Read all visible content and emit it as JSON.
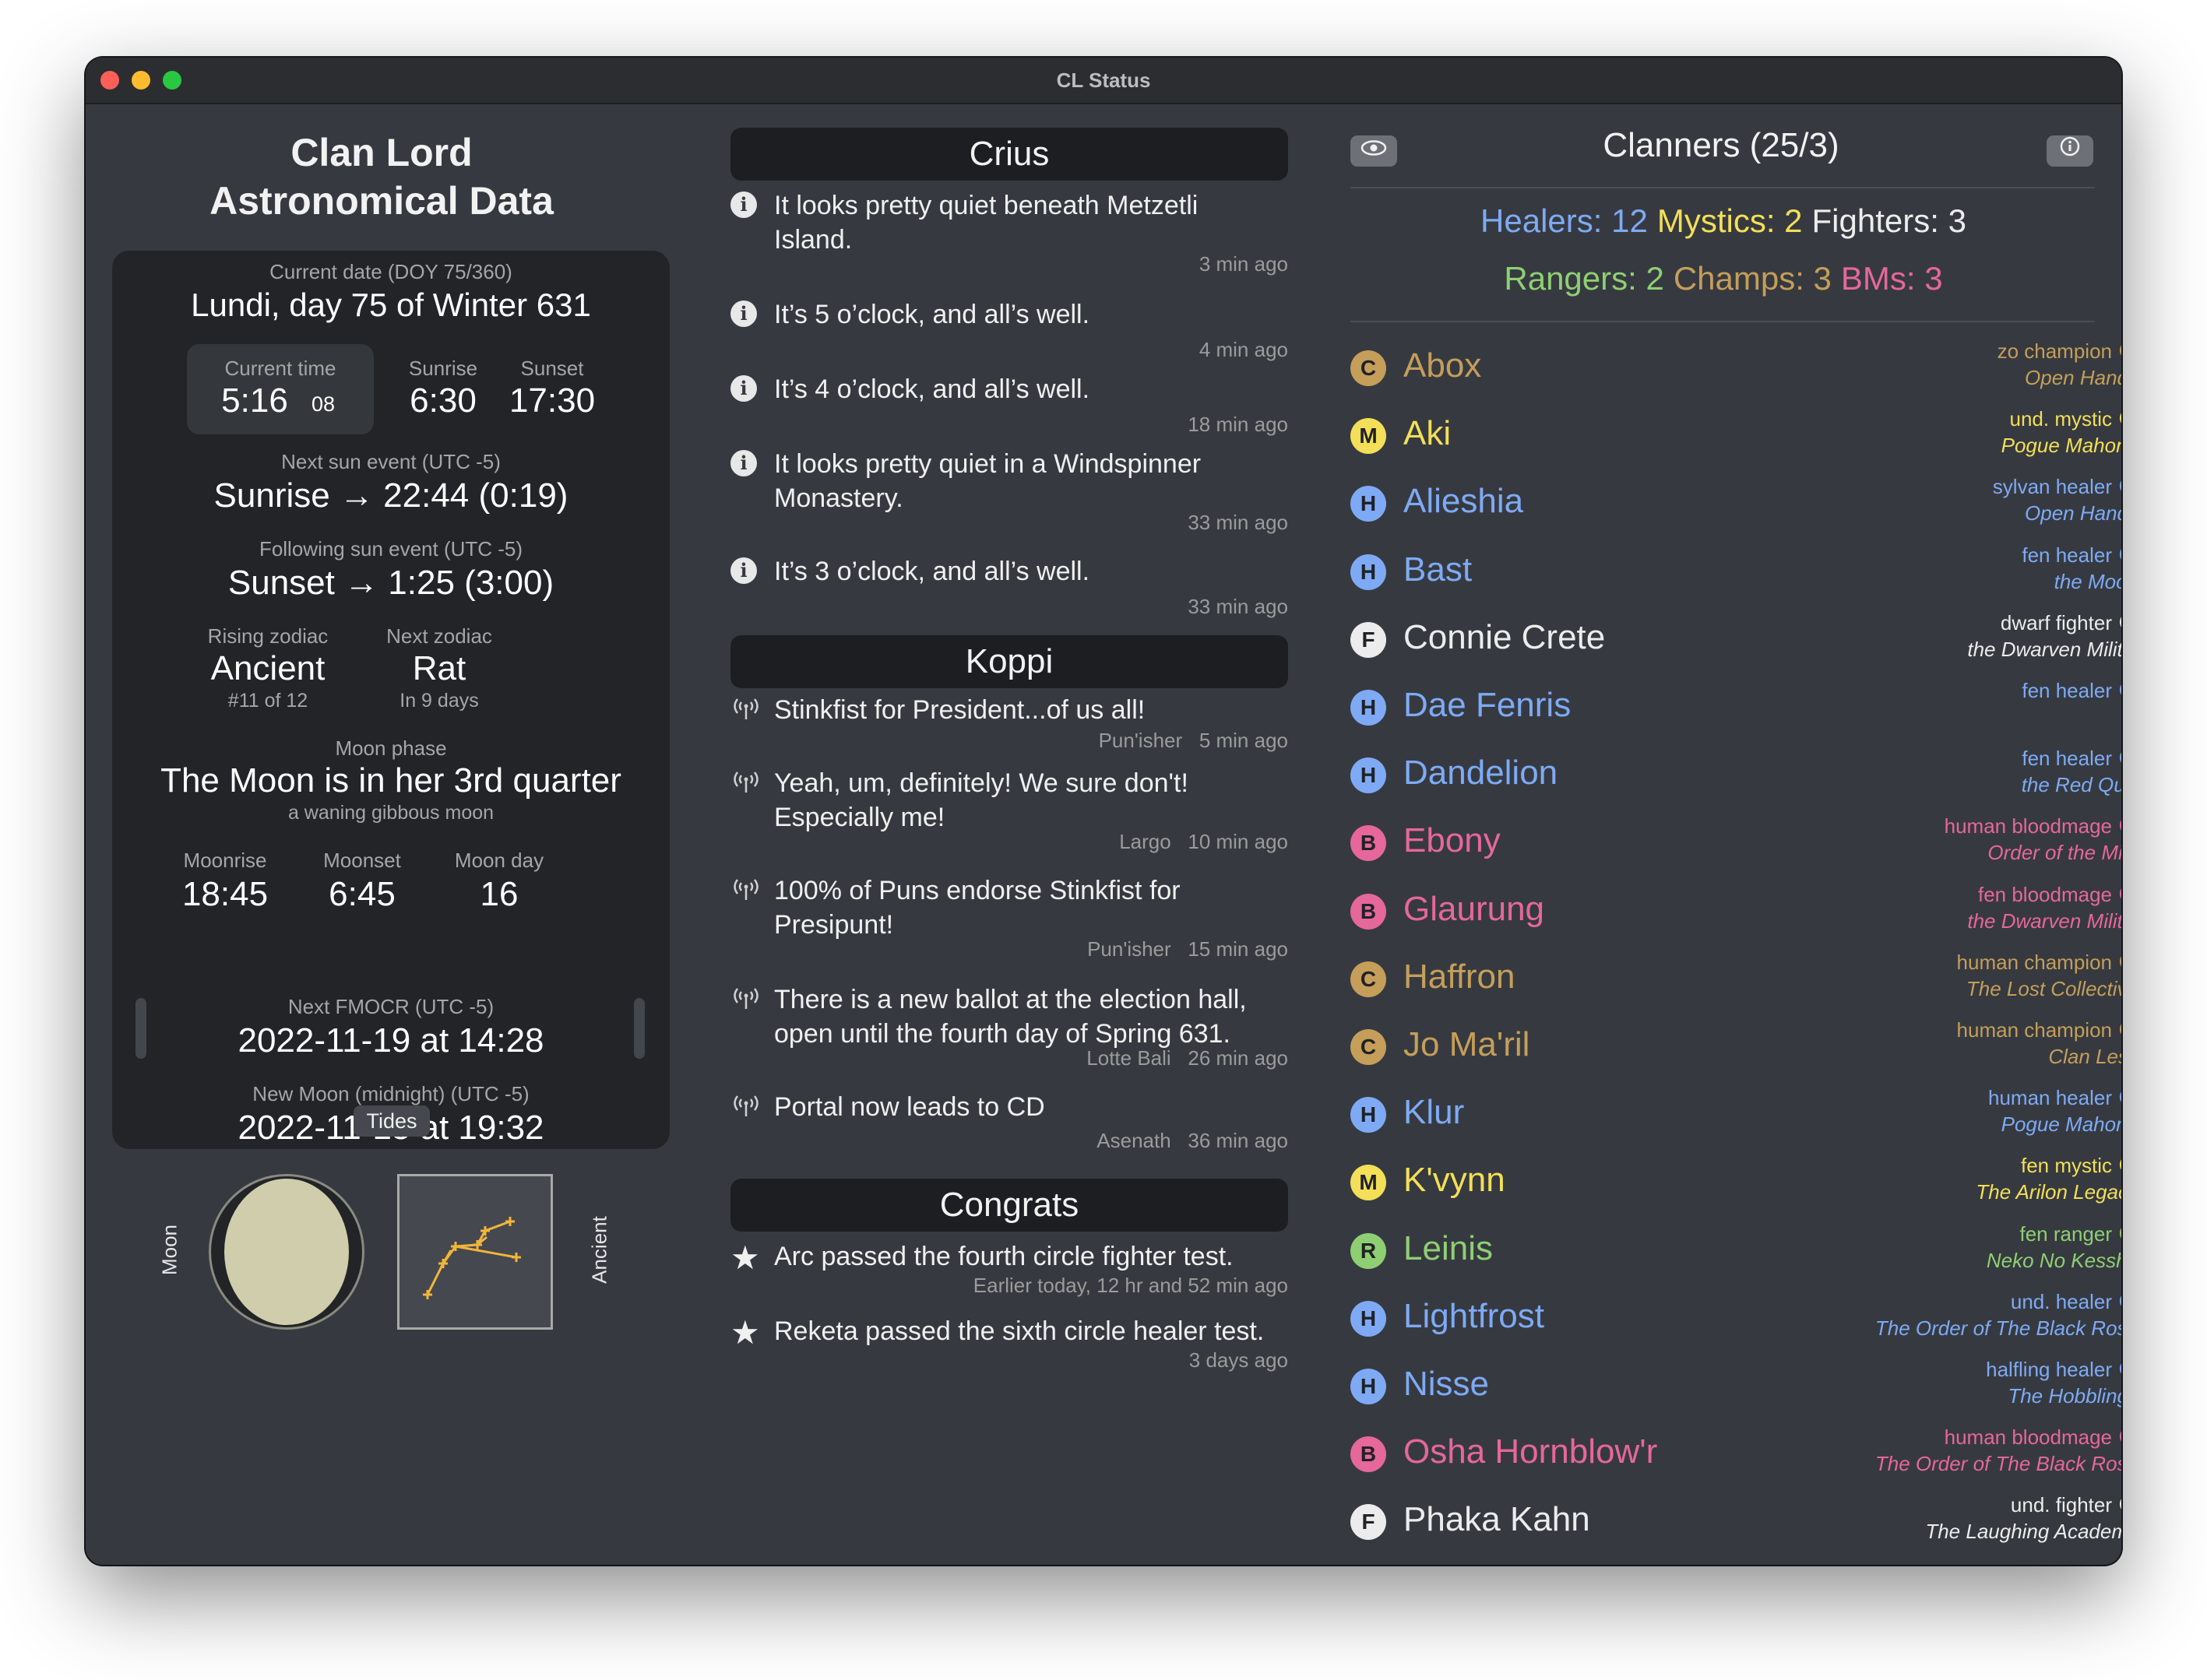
{
  "window": {
    "title": "CL Status"
  },
  "astro": {
    "title_line1": "Clan Lord",
    "title_line2": "Astronomical Data",
    "date_label": "Current date (DOY 75/360)",
    "date_value": "Lundi, day 75 of Winter 631",
    "time_label": "Current time",
    "time_value": "5:16",
    "time_seconds": "08",
    "sunrise_label": "Sunrise",
    "sunrise_value": "6:30",
    "sunset_label": "Sunset",
    "sunset_value": "17:30",
    "next_sun_label": "Next sun event (UTC -5)",
    "next_sun_value": "Sunrise → 22:44 (0:19)",
    "following_sun_label": "Following sun event (UTC -5)",
    "following_sun_value": "Sunset → 1:25 (3:00)",
    "rising_zodiac_label": "Rising zodiac",
    "rising_zodiac_value": "Ancient",
    "rising_zodiac_sub": "#11 of 12",
    "next_zodiac_label": "Next zodiac",
    "next_zodiac_value": "Rat",
    "next_zodiac_sub": "In 9 days",
    "moon_phase_label": "Moon phase",
    "moon_phase_value": "The Moon is in her 3rd quarter",
    "moon_phase_sub": "a waning gibbous moon",
    "moonrise_label": "Moonrise",
    "moonrise_value": "18:45",
    "moonset_label": "Moonset",
    "moonset_value": "6:45",
    "moon_day_label": "Moon day",
    "moon_day_value": "16",
    "fmocr_label": "Next FMOCR (UTC -5)",
    "fmocr_value": "2022-11-19 at 14:28",
    "new_moon_label": "New Moon (midnight) (UTC -5)",
    "new_moon_value": "2022-11-15 at 19:32",
    "tides_button": "Tides",
    "moon_caption": "Moon",
    "zodiac_caption": "Ancient"
  },
  "crius": {
    "title": "Crius",
    "messages": [
      {
        "icon": "info-icon",
        "text": "It looks pretty quiet beneath Metzetli Island.",
        "time": "3 min ago"
      },
      {
        "icon": "info-icon",
        "text": "It’s 5 o’clock, and all’s well.",
        "time": "4 min ago"
      },
      {
        "icon": "info-icon",
        "text": "It’s 4 o’clock, and all’s well.",
        "time": "18 min ago"
      },
      {
        "icon": "info-icon",
        "text": "It looks pretty quiet in a Windspinner Monastery.",
        "time": "33 min ago"
      },
      {
        "icon": "info-icon",
        "text": "It’s 3 o’clock, and all’s well.",
        "time": "33 min ago"
      }
    ]
  },
  "koppi": {
    "title": "Koppi",
    "messages": [
      {
        "icon": "broadcast-icon",
        "text": "Stinkfist for President...of us all!",
        "meta": "Pun'isher   5 min ago"
      },
      {
        "icon": "broadcast-icon",
        "text": "Yeah, um, definitely! We sure don't! Especially me!",
        "meta": "Largo   10 min ago"
      },
      {
        "icon": "broadcast-icon",
        "text": "100% of Puns endorse Stinkfist for Presipunt!",
        "meta": "Pun'isher   15 min ago"
      },
      {
        "icon": "broadcast-icon",
        "text": "There is a new ballot at the election hall, open until the fourth day of Spring 631.",
        "meta": "Lotte Bali   26 min ago"
      },
      {
        "icon": "broadcast-icon",
        "text": "Portal now leads to CD",
        "meta": "Asenath   36 min ago"
      }
    ]
  },
  "congrats": {
    "title": "Congrats",
    "messages": [
      {
        "icon": "star-icon",
        "text": "Arc passed the fourth circle fighter test.",
        "time": "Earlier today, 12 hr and 52 min ago"
      },
      {
        "icon": "star-icon",
        "text": "Reketa passed the sixth circle healer test.",
        "time": "3 days ago"
      }
    ]
  },
  "clanners": {
    "title": "Clanners (25/3)",
    "left_icon": "eye-icon",
    "right_icon": "info-icon",
    "stats_line1": [
      {
        "label": "Healers: 12",
        "color": "#7eaaf5"
      },
      {
        "label": "Mystics: 2",
        "color": "#f3df58"
      },
      {
        "label": "Fighters: 3",
        "color": "#ececec"
      }
    ],
    "stats_line2": [
      {
        "label": "Rangers: 2",
        "color": "#8fcf73"
      },
      {
        "label": "Champs: 3",
        "color": "#c59e5a"
      },
      {
        "label": "BMs: 3",
        "color": "#e6679b"
      }
    ],
    "list": [
      {
        "badge": "C",
        "name": "Abox",
        "race": "zo champion",
        "dot": "M",
        "dot_style": "ring",
        "clan": "Open Hands",
        "color": "#c59e5a"
      },
      {
        "badge": "M",
        "name": "Aki",
        "race": "und. mystic",
        "dot": "M",
        "dot_style": "ring",
        "clan": "Pogue Mahone",
        "color": "#f3df58"
      },
      {
        "badge": "H",
        "name": "Alieshia",
        "race": "sylvan healer",
        "dot": "F",
        "dot_style": "fill",
        "clan": "Open Hands",
        "color": "#7eaaf5"
      },
      {
        "badge": "H",
        "name": "Bast",
        "race": "fen healer",
        "dot": "F",
        "dot_style": "fill",
        "clan": "the Moon",
        "color": "#7eaaf5"
      },
      {
        "badge": "F",
        "name": "Connie Crete",
        "race": "dwarf fighter",
        "dot": "F",
        "dot_style": "fill",
        "clan": "the Dwarven Militia",
        "color": "#ececec"
      },
      {
        "badge": "H",
        "name": "Dae Fenris",
        "race": "fen healer",
        "dot": "M",
        "dot_style": "ring",
        "clan": "",
        "color": "#7eaaf5"
      },
      {
        "badge": "H",
        "name": "Dandelion",
        "race": "fen healer",
        "dot": "F",
        "dot_style": "fill",
        "clan": "the Red Quill",
        "color": "#7eaaf5"
      },
      {
        "badge": "B",
        "name": "Ebony",
        "race": "human bloodmage",
        "dot": "F",
        "dot_style": "fill",
        "clan": "Order of the Mini",
        "color": "#e6679b"
      },
      {
        "badge": "B",
        "name": "Glaurung",
        "race": "fen bloodmage",
        "dot": "M",
        "dot_style": "ring",
        "clan": "the Dwarven Militia",
        "color": "#e6679b"
      },
      {
        "badge": "C",
        "name": "Haffron",
        "race": "human champion",
        "dot": "F",
        "dot_style": "fill",
        "clan": "The Lost Collective",
        "color": "#c59e5a"
      },
      {
        "badge": "C",
        "name": "Jo Ma'ril",
        "race": "human champion",
        "dot": "M",
        "dot_style": "ring",
        "clan": "Clan Less",
        "color": "#c59e5a"
      },
      {
        "badge": "H",
        "name": "Klur",
        "race": "human healer",
        "dot": "M",
        "dot_style": "ring",
        "clan": "Pogue Mahone",
        "color": "#7eaaf5"
      },
      {
        "badge": "M",
        "name": "K'vynn",
        "race": "fen mystic",
        "dot": "M",
        "dot_style": "ring",
        "clan": "The Arilon Legacy",
        "color": "#f3df58"
      },
      {
        "badge": "R",
        "name": "Leinis",
        "race": "fen ranger",
        "dot": "M",
        "dot_style": "ring",
        "clan": "Neko No Kessha",
        "color": "#8fcf73"
      },
      {
        "badge": "H",
        "name": "Lightfrost",
        "race": "und. healer",
        "dot": "M",
        "dot_style": "ring",
        "clan": "The Order of The Black Rose",
        "color": "#7eaaf5"
      },
      {
        "badge": "H",
        "name": "Nisse",
        "race": "halfling healer",
        "dot": "M",
        "dot_style": "ring",
        "clan": "The Hobblings",
        "color": "#7eaaf5"
      },
      {
        "badge": "B",
        "name": "Osha Hornblow'r",
        "race": "human bloodmage",
        "dot": "M",
        "dot_style": "ring",
        "clan": "The Order of The Black Rose",
        "color": "#e6679b"
      },
      {
        "badge": "F",
        "name": "Phaka Kahn",
        "race": "und. fighter",
        "dot": "F",
        "dot_style": "fill",
        "clan": "The Laughing Academy",
        "color": "#ececec"
      }
    ]
  }
}
